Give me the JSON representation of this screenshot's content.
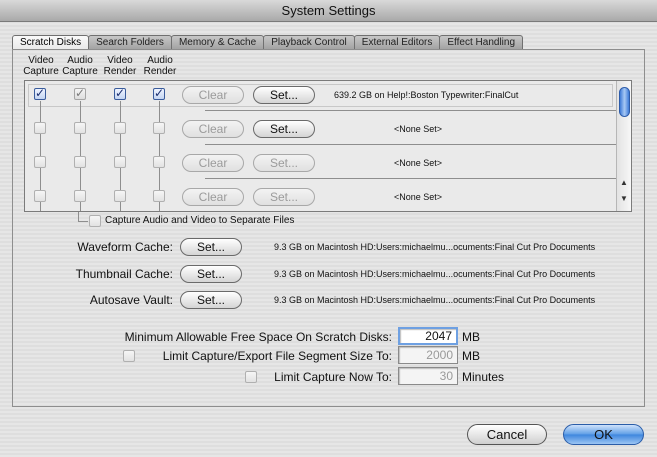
{
  "window": {
    "title": "System Settings"
  },
  "tabs": [
    "Scratch Disks",
    "Search Folders",
    "Memory & Cache",
    "Playback Control",
    "External Editors",
    "Effect Handling"
  ],
  "columns": [
    {
      "line1": "Video",
      "line2": "Capture"
    },
    {
      "line1": "Audio",
      "line2": "Capture"
    },
    {
      "line1": "Video",
      "line2": "Render"
    },
    {
      "line1": "Audio",
      "line2": "Render"
    }
  ],
  "scratch_disks": [
    {
      "checks": [
        true,
        true,
        true,
        true
      ],
      "clear_label": "Clear",
      "set_label": "Set...",
      "path": "639.2 GB on Help!:Boston Typewriter:FinalCut"
    },
    {
      "checks": [
        false,
        false,
        false,
        false
      ],
      "clear_label": "Clear",
      "set_label": "Set...",
      "path": "<None Set>"
    },
    {
      "checks": [
        false,
        false,
        false,
        false
      ],
      "clear_label": "Clear",
      "set_label": "Set...",
      "path": "<None Set>"
    },
    {
      "checks": [
        false,
        false,
        false,
        false
      ],
      "clear_label": "Clear",
      "set_label": "Set...",
      "path": "<None Set>"
    }
  ],
  "separate_files": {
    "label": "Capture Audio and Video to Separate Files",
    "checked": false
  },
  "caches": [
    {
      "label": "Waveform Cache:",
      "set_label": "Set...",
      "path": "9.3 GB on  Macintosh HD:Users:michaelmu...ocuments:Final Cut Pro Documents"
    },
    {
      "label": "Thumbnail Cache:",
      "set_label": "Set...",
      "path": "9.3 GB on  Macintosh HD:Users:michaelmu...ocuments:Final Cut Pro Documents"
    },
    {
      "label": "Autosave Vault:",
      "set_label": "Set...",
      "path": "9.3 GB on  Macintosh HD:Users:michaelmu...ocuments:Final Cut Pro Documents"
    }
  ],
  "min_free": {
    "label": "Minimum Allowable Free Space On Scratch Disks:",
    "value": "2047",
    "unit": "MB"
  },
  "limit_segment": {
    "label": "Limit Capture/Export File Segment Size To:",
    "value": "2000",
    "unit": "MB",
    "checked": false
  },
  "limit_capture": {
    "label": "Limit Capture Now To:",
    "value": "30",
    "unit": "Minutes",
    "checked": false
  },
  "footer": {
    "cancel_label": "Cancel",
    "ok_label": "OK"
  },
  "icons": {
    "scroll_up": "▲",
    "scroll_down": "▼",
    "checkmark": "✓"
  }
}
